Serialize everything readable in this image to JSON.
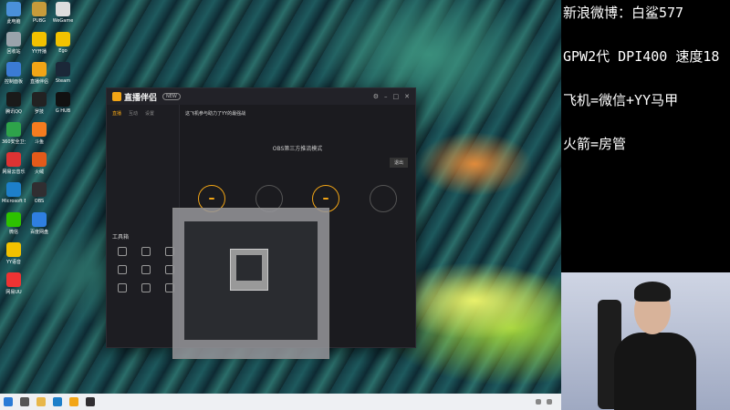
{
  "overlay": {
    "lines": [
      "新浪微博：白鲨577",
      "GPW2代 DPI400 速度18",
      "飞机=微信+YY马甲",
      "火箭=房管"
    ]
  },
  "desktop": {
    "icons_col1": [
      {
        "label": "此电脑",
        "icon": "computer-icon",
        "color": "#4a90d9"
      },
      {
        "label": "回收站",
        "icon": "recycle-bin-icon",
        "color": "#9aa3ab"
      },
      {
        "label": "控制面板",
        "icon": "control-panel-icon",
        "color": "#3b7bd4"
      },
      {
        "label": "腾讯QQ",
        "icon": "qq-icon",
        "color": "#1a1a1a"
      },
      {
        "label": "360安全卫士",
        "icon": "security-icon",
        "color": "#2ea34a"
      },
      {
        "label": "网易云音乐",
        "icon": "music-icon",
        "color": "#d33"
      },
      {
        "label": "Microsoft Edge",
        "icon": "edge-icon",
        "color": "#1d7fc9"
      },
      {
        "label": "微信",
        "icon": "wechat-icon",
        "color": "#2dc100"
      },
      {
        "label": "YY语音",
        "icon": "yy-icon",
        "color": "#f2c200"
      },
      {
        "label": "网易UU",
        "icon": "netease-icon",
        "color": "#e33"
      }
    ],
    "icons_col2": [
      {
        "label": "PUBG",
        "icon": "game-icon",
        "color": "#c79b3b"
      },
      {
        "label": "YY开播",
        "icon": "yy-live-icon",
        "color": "#f2c200"
      },
      {
        "label": "直播伴侣",
        "icon": "live-companion-icon",
        "color": "#f2a516"
      },
      {
        "label": "罗技",
        "icon": "logitech-icon",
        "color": "#222"
      },
      {
        "label": "斗鱼",
        "icon": "douyu-icon",
        "color": "#f57c1f"
      },
      {
        "label": "火绒",
        "icon": "firewall-icon",
        "color": "#e35a1a"
      },
      {
        "label": "OBS",
        "icon": "obs-icon",
        "color": "#302e31"
      },
      {
        "label": "百度网盘",
        "icon": "cloud-icon",
        "color": "#2f7fe0"
      }
    ],
    "icons_col3": [
      {
        "label": "WeGame",
        "icon": "wegame-icon",
        "color": "#ddd"
      },
      {
        "label": "Ego",
        "icon": "ego-icon",
        "color": "#f2c200"
      },
      {
        "label": "Steam",
        "icon": "steam-icon",
        "color": "#1b2838"
      },
      {
        "label": "G HUB",
        "icon": "ghub-icon",
        "color": "#111"
      }
    ]
  },
  "app": {
    "name": "直播伴侣",
    "badge": "NEW",
    "left_tabs": [
      "直播",
      "互动",
      "设置"
    ],
    "tools_title": "工具箱",
    "stream_title": "这飞机参与助力了YY的最强战",
    "mode_title": "OBS第三方推流模式",
    "mode_button": "退出"
  }
}
